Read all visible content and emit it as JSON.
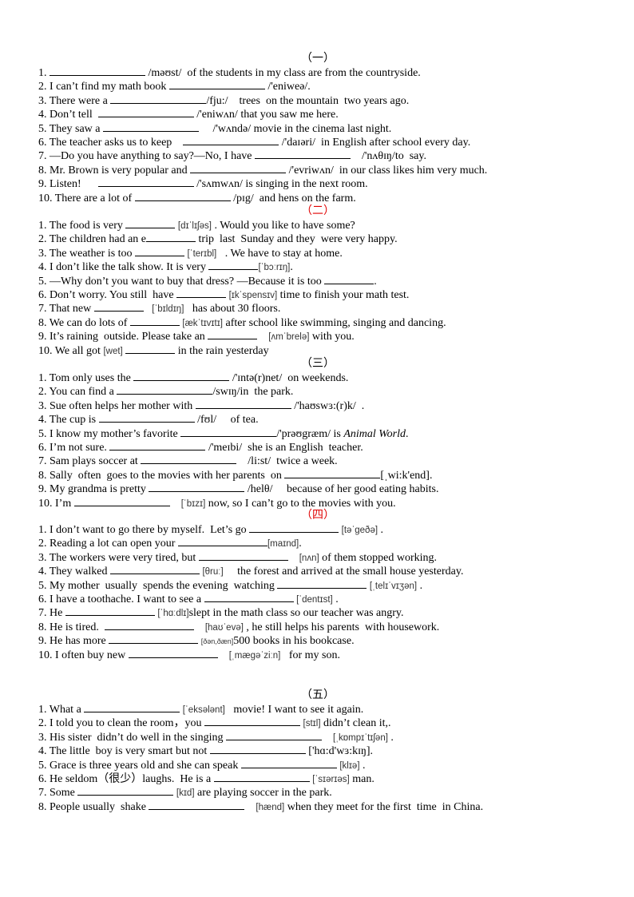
{
  "sections": [
    {
      "title": "（一）",
      "red": false,
      "items": [
        [
          {
            "t": "1. "
          },
          {
            "b": 1
          },
          {
            "t": " /məʊst/  of the students in my class are from the countryside."
          }
        ],
        [
          {
            "t": "2. I can’t find my math book "
          },
          {
            "b": 1
          },
          {
            "t": " /'eniweə/."
          }
        ],
        [
          {
            "t": "3. There were a "
          },
          {
            "b": 1
          },
          {
            "t": "/fju:/    trees  on the mountain  two years ago."
          }
        ],
        [
          {
            "t": "4. Don’t tell  "
          },
          {
            "b": 1
          },
          {
            "t": " /'eniwʌn/ that you saw me here."
          }
        ],
        [
          {
            "t": "5. They saw a "
          },
          {
            "b": 1
          },
          {
            "t": "     /'wʌndə/ movie in the cinema last night."
          }
        ],
        [
          {
            "t": "6. The teacher asks us to keep    "
          },
          {
            "b": 1
          },
          {
            "t": " /'daɪəri/  in English after school every day."
          }
        ],
        [
          {
            "t": "7. —Do you have anything to say?—No, I have "
          },
          {
            "b": 1
          },
          {
            "t": "    /'nʌθɪŋ/to  say."
          }
        ],
        [
          {
            "t": "8. Mr. Brown is very popular and "
          },
          {
            "b": 1
          },
          {
            "t": " /'evriwʌn/  in our class likes him very much."
          }
        ],
        [
          {
            "t": "9. Listen!      "
          },
          {
            "b": 1
          },
          {
            "t": " /'sʌmwʌn/ is singing in the next room."
          }
        ],
        [
          {
            "t": "10. There are a lot of "
          },
          {
            "b": 1
          },
          {
            "t": " /pɪg/  and hens on the farm."
          }
        ]
      ]
    },
    {
      "title": "（二）",
      "red": true,
      "items": [
        [
          {
            "t": "1. The food is very "
          },
          {
            "b": 1
          },
          {
            "t": " "
          },
          {
            "p": "[dɪˈlɪʃəs]"
          },
          {
            "t": " . Would you like to have some?"
          }
        ],
        [
          {
            "t": "2. The children had an e"
          },
          {
            "b": 1
          },
          {
            "t": " trip  last  Sunday and they  were very happy."
          }
        ],
        [
          {
            "t": "3. The weather is too "
          },
          {
            "b": 1
          },
          {
            "t": " "
          },
          {
            "p": "[ˈterɪbl]"
          },
          {
            "t": "   . We have to stay at home."
          }
        ],
        [
          {
            "t": "4. I don’t like the talk show. It is very "
          },
          {
            "b": 1
          },
          {
            "p": "[ˈbɔːrɪŋ]"
          },
          {
            "t": "."
          }
        ],
        [
          {
            "t": "5. —Why don’t you want to buy that dress? —Because it is too "
          },
          {
            "b": 1
          },
          {
            "t": "."
          }
        ],
        [
          {
            "t": "6. Don’t worry. You still  have "
          },
          {
            "b": 1
          },
          {
            "t": " "
          },
          {
            "p": "[ɪkˈspensɪv]"
          },
          {
            "t": " time to finish your math test."
          }
        ],
        [
          {
            "t": "7. That new "
          },
          {
            "b": 1
          },
          {
            "t": "   "
          },
          {
            "p": "[ˈbɪldɪŋ]"
          },
          {
            "t": "   has about 30 floors."
          }
        ],
        [
          {
            "t": "8. We can do lots of "
          },
          {
            "b": 1
          },
          {
            "t": " "
          },
          {
            "p": "[ækˈtɪvɪtɪ]"
          },
          {
            "t": " after school like swimming, singing and dancing."
          }
        ],
        [
          {
            "t": "9. It’s raining  outside. Please take an "
          },
          {
            "b": 1
          },
          {
            "t": "    "
          },
          {
            "p": "[ʌmˈbrelə]"
          },
          {
            "t": " with you."
          }
        ],
        [
          {
            "t": "10. We all got "
          },
          {
            "p": "[wet]"
          },
          {
            "t": " "
          },
          {
            "b": 1
          },
          {
            "t": " in the rain yesterday"
          }
        ]
      ]
    },
    {
      "title": "（三）",
      "red": false,
      "items": [
        [
          {
            "t": "1. Tom only uses the "
          },
          {
            "b": 1
          },
          {
            "t": " /'ɪntə(r)net/  on weekends."
          }
        ],
        [
          {
            "t": "2. You can find a "
          },
          {
            "b": 1
          },
          {
            "t": "/swɪŋ/in  the park."
          }
        ],
        [
          {
            "t": "3. Sue often helps her mother with "
          },
          {
            "b": 1
          },
          {
            "t": " /'haʊswɜ:(r)k/  ."
          }
        ],
        [
          {
            "t": "4. The cup is "
          },
          {
            "b": 1
          },
          {
            "t": " /fʊl/     of tea."
          }
        ],
        [
          {
            "t": "5. I know my mother’s favorite "
          },
          {
            "b": 1
          },
          {
            "t": "/'prəʊgræm/ is "
          },
          {
            "i": "Animal World"
          },
          {
            "t": "."
          }
        ],
        [
          {
            "t": "6. I’m not sure. "
          },
          {
            "b": 1
          },
          {
            "t": " /'meɪbi/  she is an English  teacher."
          }
        ],
        [
          {
            "t": "7. Sam plays soccer at "
          },
          {
            "b": 1
          },
          {
            "t": "    /li:st/  twice a week."
          }
        ],
        [
          {
            "t": "8. Sally  often  goes to the movies with her parents  on "
          },
          {
            "b": 1
          },
          {
            "t": "[ˌwi:k'end]."
          }
        ],
        [
          {
            "t": "9. My grandma is pretty "
          },
          {
            "b": 1
          },
          {
            "t": " /helθ/     because of her good eating habits."
          }
        ],
        [
          {
            "t": "10. I’m "
          },
          {
            "b": 1
          },
          {
            "t": "    "
          },
          {
            "p": "[ˈbɪzɪ]"
          },
          {
            "t": " now, so I can’t go to the movies with you."
          }
        ]
      ]
    },
    {
      "title": "（四）",
      "red": true,
      "items": [
        [
          {
            "t": "1. I don’t want to go there by myself.  Let’s go "
          },
          {
            "b": 1
          },
          {
            "t": " "
          },
          {
            "p": "[təˈgeðə]"
          },
          {
            "t": " ."
          }
        ],
        [
          {
            "t": "2. Reading a lot can open your "
          },
          {
            "b": 1
          },
          {
            "p": "[maɪnd]"
          },
          {
            "t": "."
          }
        ],
        [
          {
            "t": "3. The workers were very tired, but "
          },
          {
            "b": 1
          },
          {
            "t": "    "
          },
          {
            "p": "[nʌn]"
          },
          {
            "t": " of them stopped working."
          }
        ],
        [
          {
            "t": "4. They walked "
          },
          {
            "b": 1
          },
          {
            "t": " "
          },
          {
            "p": "[θruː]"
          },
          {
            "t": "     the forest and arrived at the small house yesterday."
          }
        ],
        [
          {
            "t": "5. My mother  usually  spends the evening  watching "
          },
          {
            "b": 1
          },
          {
            "t": " "
          },
          {
            "p": "[ˌtelɪˈvɪʒən]"
          },
          {
            "t": " ."
          }
        ],
        [
          {
            "t": "6. I have a toothache. I want to see a "
          },
          {
            "b": 1
          },
          {
            "t": " "
          },
          {
            "p": "[ˈdentɪst]"
          },
          {
            "t": " ."
          }
        ],
        [
          {
            "t": "7. He "
          },
          {
            "b": 1
          },
          {
            "t": " "
          },
          {
            "p": "[ˈhɑːdlɪ]"
          },
          {
            "t": "slept in the math class so our teacher was angry."
          }
        ],
        [
          {
            "t": "8. He is tired.  "
          },
          {
            "b": 1
          },
          {
            "t": "    "
          },
          {
            "p": "[haʊˈevə]"
          },
          {
            "t": " , he still helps his parents  with housework."
          }
        ],
        [
          {
            "t": "9. He has more "
          },
          {
            "b": 1
          },
          {
            "t": " "
          },
          {
            "s": "[ðən,ðæn]"
          },
          {
            "t": "500 books in his bookcase."
          }
        ],
        [
          {
            "t": "10. I often buy new "
          },
          {
            "b": 1
          },
          {
            "t": "    "
          },
          {
            "p": "[ˌmægəˈziːn]"
          },
          {
            "t": "   for my son."
          }
        ]
      ]
    },
    {
      "title": "（五）",
      "red": false,
      "items": [
        [
          {
            "t": "1. What a "
          },
          {
            "b": 1
          },
          {
            "t": " "
          },
          {
            "p": "[ˈeksələnt]"
          },
          {
            "t": "   movie! I want to see it again."
          }
        ],
        [
          {
            "t": "2. I told you to clean the room，you "
          },
          {
            "b": 1
          },
          {
            "t": " "
          },
          {
            "p": "[stɪl]"
          },
          {
            "t": " didn’t clean it,."
          }
        ],
        [
          {
            "t": "3. His sister  didn’t do well in the singing "
          },
          {
            "b": 1
          },
          {
            "t": "    "
          },
          {
            "p": "[ˌkɒmpɪˈtɪʃən]"
          },
          {
            "t": " ."
          }
        ],
        [
          {
            "t": "4. The little  boy is very smart but not "
          },
          {
            "b": 1
          },
          {
            "t": " ['hɑ:d'wɜ:kɪŋ]."
          }
        ],
        [
          {
            "t": "5. Grace is three years old and she can speak "
          },
          {
            "b": 1
          },
          {
            "t": " "
          },
          {
            "p": "[klɪə]"
          },
          {
            "t": " ."
          }
        ],
        [
          {
            "t": "6. He seldom（很少）laughs.  He is a "
          },
          {
            "b": 1
          },
          {
            "t": " "
          },
          {
            "p": "[ˈsɪərɪəs]"
          },
          {
            "t": " man."
          }
        ],
        [
          {
            "t": "7. Some "
          },
          {
            "b": 1
          },
          {
            "t": " "
          },
          {
            "p": "[kɪd]"
          },
          {
            "t": " are playing soccer in the park."
          }
        ],
        [
          {
            "t": "8. People usually  shake "
          },
          {
            "b": 1
          },
          {
            "t": "    "
          },
          {
            "p": "[hænd]"
          },
          {
            "t": " when they meet for the first  time  in China."
          }
        ]
      ]
    }
  ],
  "colors": {
    "text": "#000000",
    "section_red": "#e00000"
  }
}
